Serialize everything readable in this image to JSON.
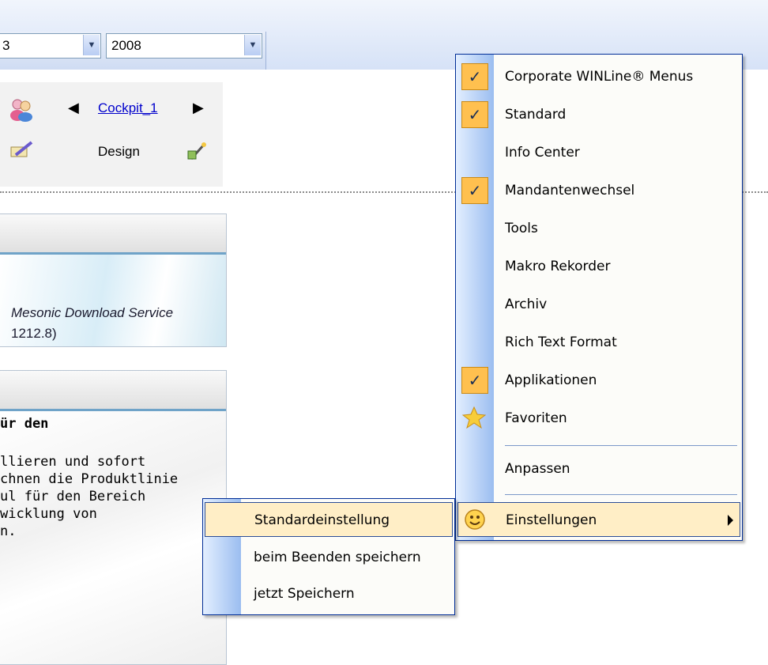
{
  "toolbar": {
    "combo_left_value": "3",
    "combo_year_value": "2008",
    "dropdown_glyph": "▼"
  },
  "cockpit": {
    "link": "Cockpit_1",
    "design_label": "Design"
  },
  "box1": {
    "line1": "Mesonic Download Service",
    "line2": "1212.8)"
  },
  "box2": {
    "title": "ür den",
    "lines": [
      "llieren und sofort",
      "chnen die Produktlinie",
      "ul für den Bereich",
      "wicklung von",
      "n."
    ]
  },
  "context_menu": {
    "items": [
      {
        "label": "Corporate WINLine® Menus",
        "checked": true
      },
      {
        "label": "Standard",
        "checked": true
      },
      {
        "label": "Info Center",
        "checked": false
      },
      {
        "label": "Mandantenwechsel",
        "checked": true
      },
      {
        "label": "Tools",
        "checked": false
      },
      {
        "label": "Makro Rekorder",
        "checked": false
      },
      {
        "label": "Archiv",
        "checked": false
      },
      {
        "label": "Rich Text Format",
        "checked": false
      },
      {
        "label": "Applikationen",
        "checked": true
      },
      {
        "label": "Favoriten",
        "icon": "star-icon"
      },
      {
        "label": "Anpassen"
      },
      {
        "label": "Einstellungen",
        "icon": "smiley-icon",
        "has_submenu": true
      }
    ],
    "check_glyph": "✓"
  },
  "submenu": {
    "items": [
      {
        "label": "Standardeinstellung",
        "highlighted": true
      },
      {
        "label": "beim Beenden speichern"
      },
      {
        "label": "jetzt Speichern"
      }
    ]
  },
  "colors": {
    "menu_highlight": "#ffeec6",
    "check_bg": "#ffc04f",
    "menu_border": "#002d96"
  }
}
